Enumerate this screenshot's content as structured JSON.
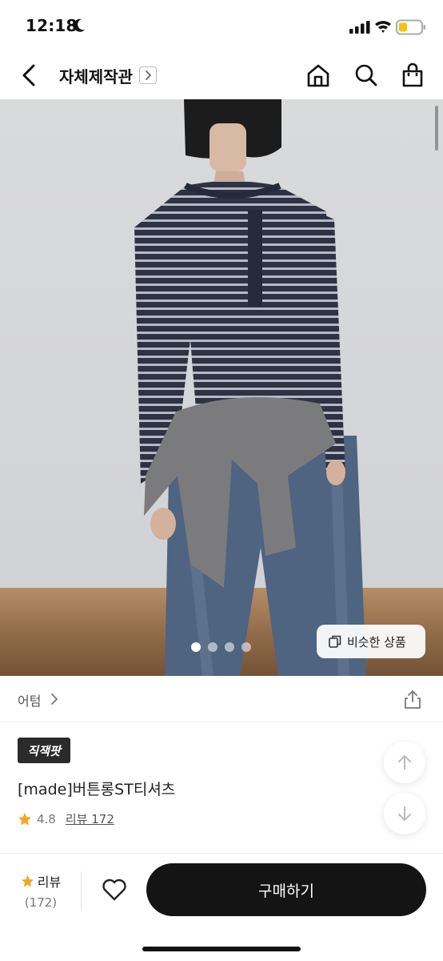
{
  "status_bar": {
    "time": "12:18"
  },
  "nav": {
    "title": "자체제작관"
  },
  "hero": {
    "slide_count": 4,
    "active_slide": 1,
    "similar_label": "비슷한 상품"
  },
  "brand": {
    "name": "어텀"
  },
  "product": {
    "badge": "직잭팟",
    "name": "[made]버튼롱ST티셔츠",
    "rating": "4.8",
    "review_link": "리뷰 172"
  },
  "bottom_bar": {
    "review_label": "리뷰",
    "review_count": "(172)",
    "buy_label": "구매하기"
  },
  "colors": {
    "accent_star": "#f5a524",
    "buy_button": "#141414"
  }
}
